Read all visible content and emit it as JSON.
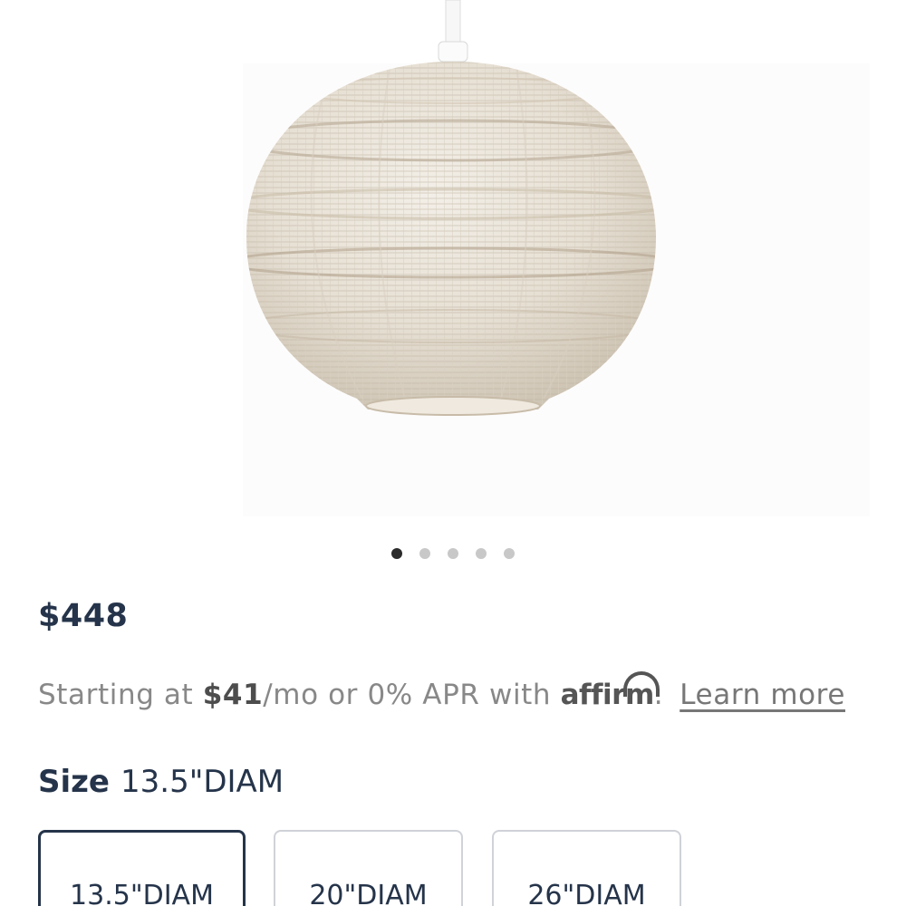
{
  "gallery": {
    "image_alt": "Round woven rattan pendant lamp",
    "slide_count": 5,
    "active_slide": 1
  },
  "product": {
    "price": "$448"
  },
  "financing": {
    "prefix": "Starting at ",
    "amount": "$41",
    "suffix": "/mo or 0% APR with ",
    "provider": "affirm",
    "period": ".",
    "learn_more": "Learn more"
  },
  "size": {
    "label": "Size",
    "selected_value": "13.5\"DIAM",
    "options": [
      "13.5\"DIAM",
      "20\"DIAM",
      "26\"DIAM"
    ]
  },
  "colors": {
    "text_navy": "#25344a",
    "muted_gray": "#888888",
    "dot_active": "#2b2b2b",
    "dot_inactive": "#c8c8c8"
  }
}
